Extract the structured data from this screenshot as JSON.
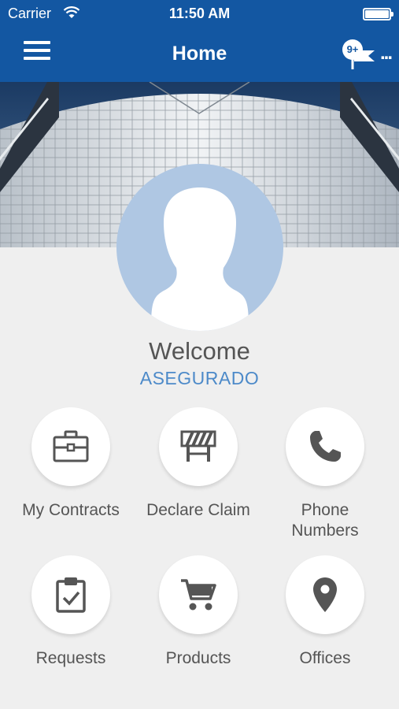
{
  "status_bar": {
    "carrier": "Carrier",
    "time": "11:50 AM"
  },
  "nav": {
    "title": "Home",
    "notification_badge": "9+",
    "more_label": "..."
  },
  "profile": {
    "welcome": "Welcome",
    "user_role": "ASEGURADO"
  },
  "menu": {
    "items": [
      {
        "label": "My Contracts",
        "icon": "briefcase-icon"
      },
      {
        "label": "Declare Claim",
        "icon": "barrier-icon"
      },
      {
        "label": "Phone\nNumbers",
        "icon": "phone-icon"
      },
      {
        "label": "Requests",
        "icon": "clipboard-check-icon"
      },
      {
        "label": "Products",
        "icon": "cart-icon"
      },
      {
        "label": "Offices",
        "icon": "location-pin-icon"
      }
    ]
  },
  "colors": {
    "header": "#1357a2",
    "accent": "#4d8ac9",
    "avatar": "#afc7e3",
    "icon": "#555555",
    "background": "#efefef"
  }
}
